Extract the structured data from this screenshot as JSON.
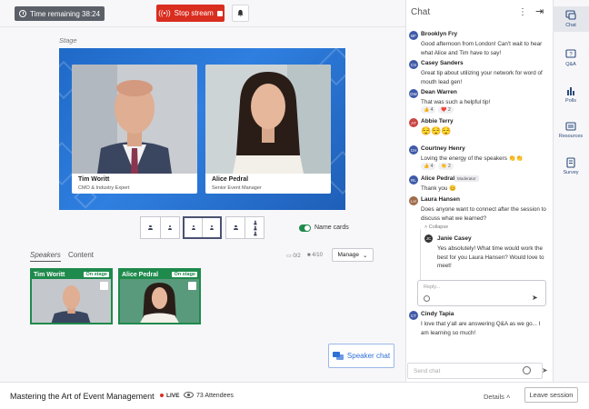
{
  "header": {
    "time_remaining": "Time remaining 38:24",
    "stop_stream": "Stop stream"
  },
  "stage": {
    "label": "Stage",
    "tiles": [
      {
        "name": "Tim Woritt",
        "title": "CMO & Industry Expert"
      },
      {
        "name": "Alice Pedral",
        "title": "Senior Event Manager"
      }
    ],
    "name_cards_label": "Name cards",
    "name_cards_on": true
  },
  "speakers": {
    "tabs": [
      "Speakers",
      "Content"
    ],
    "count_a": "0/2",
    "count_b": "4/10",
    "manage_label": "Manage",
    "cards": [
      {
        "name": "Tim Woritt",
        "badge": "On stage"
      },
      {
        "name": "Alice Pedral",
        "badge": "On stage"
      }
    ]
  },
  "speaker_chat_label": "Speaker chat",
  "footer": {
    "event_title": "Mastering the Art of Event Management",
    "live": "LIVE",
    "attendees": "73 Attendees",
    "details": "Details",
    "leave": "Leave session"
  },
  "chat": {
    "title": "Chat",
    "messages": [
      {
        "initials": "BF",
        "name": "Brooklyn Fry",
        "text": "Good afternoon from London! Can't wait to hear what Alice and Tim have to say!",
        "color": "#3f5aa8"
      },
      {
        "initials": "CS",
        "name": "Casey Sanders",
        "text": "Great tip about utilizing your network for word of mouth lead gen!",
        "color": "#3f5aa8"
      },
      {
        "initials": "DW",
        "name": "Dean Warren",
        "text": "That was such a helpful tip!",
        "color": "#3f5aa8",
        "reactions": [
          "👍 4",
          "❤️ 2"
        ]
      },
      {
        "initials": "AT",
        "name": "Abbie Terry",
        "text": "😌😌😌",
        "color": "#c44"
      },
      {
        "initials": "CH",
        "name": "Courtney Henry",
        "text": "Loving the energy of the speakers 👏👏",
        "color": "#3f5aa8",
        "reactions": [
          "👍 4",
          "👏 2"
        ]
      },
      {
        "initials": "RL",
        "name": "Alice Pedral",
        "tag": "Moderator",
        "text": "Thank you 😊",
        "color": "#3f5aa8"
      },
      {
        "initials": "LH",
        "name": "Laura Hansen",
        "text": "Does anyone want to connect after the session to discuss what we learned?",
        "color": "#a06b4a"
      },
      {
        "initials": "CT",
        "name": "Cindy Tapia",
        "text": "I love that y'all are answering Q&A as we go... I am learning so much!",
        "color": "#3f5aa8"
      }
    ],
    "thread": {
      "collapse": "Collapse",
      "initials": "JC",
      "name": "Janie Casey",
      "text": "Yes absolutely! What time would work the best for you Laura Hansen? Would love to meet!"
    },
    "reply_placeholder": "Reply...",
    "send_placeholder": "Send chat"
  },
  "rail": [
    "Chat",
    "Q&A",
    "Polls",
    "Resources",
    "Survey"
  ],
  "colors": {
    "accent": "#1e8a4c",
    "stop": "#d92d20",
    "brand": "#2c4b7c"
  }
}
